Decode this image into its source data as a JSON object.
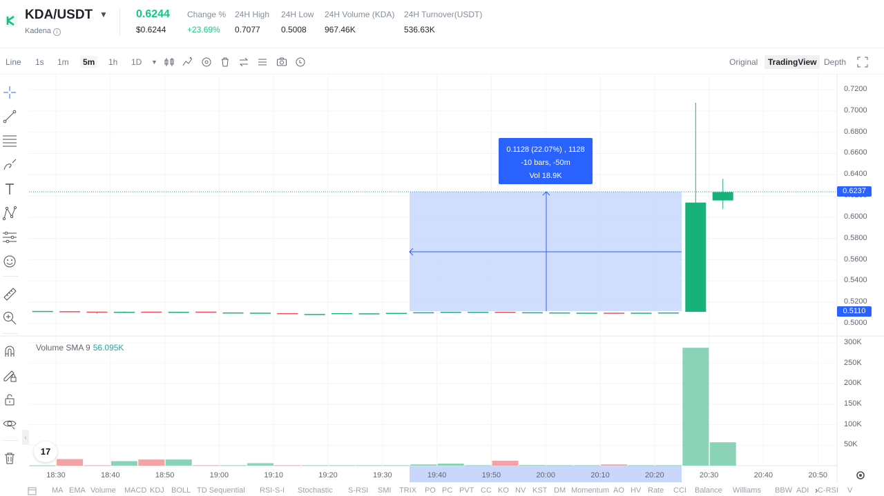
{
  "header": {
    "pair": "KDA/USDT",
    "name": "Kadena",
    "price": "0.6244",
    "price_usd": "$0.6244",
    "stats": [
      {
        "label": "Change %",
        "value": "+23.69%",
        "up": true
      },
      {
        "label": "24H High",
        "value": "0.7077"
      },
      {
        "label": "24H Low",
        "value": "0.5008"
      },
      {
        "label": "24H Volume (KDA)",
        "value": "967.46K"
      },
      {
        "label": "24H Turnover(USDT)",
        "value": "536.63K"
      }
    ]
  },
  "toolbar": {
    "intervals": [
      "Line",
      "1s",
      "1m",
      "5m",
      "1h",
      "1D"
    ],
    "active_interval": "5m",
    "views": [
      "Original",
      "TradingView",
      "Depth"
    ],
    "active_view": "TradingView"
  },
  "chart_data": {
    "type": "candlestick",
    "y_ticks": [
      "0.7200",
      "0.7000",
      "0.6800",
      "0.6600",
      "0.6400",
      "0.6200",
      "0.6000",
      "0.5800",
      "0.5600",
      "0.5400",
      "0.5200",
      "0.5000"
    ],
    "ylim": [
      0.4995,
      0.7215
    ],
    "current_price_tag": "0.6237",
    "measure_low_tag": "0.5110",
    "measure_tooltip": {
      "line1": "0.1128 (22.07%) , 1128",
      "line2": "-10 bars, -50m",
      "line3": "Vol 18.9K"
    },
    "candles": [
      {
        "o": 0.5118,
        "c": 0.5118,
        "h": 0.5118,
        "l": 0.5118,
        "up": true
      },
      {
        "o": 0.5116,
        "c": 0.5114,
        "h": 0.5116,
        "l": 0.5112,
        "up": false
      },
      {
        "o": 0.5112,
        "c": 0.5108,
        "h": 0.5112,
        "l": 0.5094,
        "up": false
      },
      {
        "o": 0.5104,
        "c": 0.511,
        "h": 0.5114,
        "l": 0.5104,
        "up": true
      },
      {
        "o": 0.5112,
        "c": 0.5108,
        "h": 0.5112,
        "l": 0.5108,
        "up": false
      },
      {
        "o": 0.5104,
        "c": 0.511,
        "h": 0.5112,
        "l": 0.5104,
        "up": true
      },
      {
        "o": 0.5112,
        "c": 0.5106,
        "h": 0.5112,
        "l": 0.5106,
        "up": false
      },
      {
        "o": 0.5104,
        "c": 0.5104,
        "h": 0.5104,
        "l": 0.5104,
        "up": true
      },
      {
        "o": 0.5102,
        "c": 0.5102,
        "h": 0.5102,
        "l": 0.5102,
        "up": true
      },
      {
        "o": 0.5098,
        "c": 0.5092,
        "h": 0.5098,
        "l": 0.509,
        "up": false
      },
      {
        "o": 0.509,
        "c": 0.509,
        "h": 0.509,
        "l": 0.509,
        "up": true
      },
      {
        "o": 0.5094,
        "c": 0.5098,
        "h": 0.5098,
        "l": 0.5094,
        "up": true
      },
      {
        "o": 0.5096,
        "c": 0.5096,
        "h": 0.5096,
        "l": 0.5096,
        "up": true
      },
      {
        "o": 0.51,
        "c": 0.51,
        "h": 0.51,
        "l": 0.51,
        "up": true
      },
      {
        "o": 0.5102,
        "c": 0.5106,
        "h": 0.5106,
        "l": 0.5102,
        "up": true
      },
      {
        "o": 0.5108,
        "c": 0.511,
        "h": 0.511,
        "l": 0.5108,
        "up": true
      },
      {
        "o": 0.511,
        "c": 0.511,
        "h": 0.511,
        "l": 0.511,
        "up": true
      },
      {
        "o": 0.511,
        "c": 0.5106,
        "h": 0.511,
        "l": 0.5106,
        "up": false
      },
      {
        "o": 0.5106,
        "c": 0.5104,
        "h": 0.5106,
        "l": 0.5104,
        "up": true
      },
      {
        "o": 0.5104,
        "c": 0.5104,
        "h": 0.5104,
        "l": 0.5104,
        "up": true
      },
      {
        "o": 0.5102,
        "c": 0.5102,
        "h": 0.5102,
        "l": 0.5102,
        "up": true
      },
      {
        "o": 0.5102,
        "c": 0.51,
        "h": 0.5102,
        "l": 0.51,
        "up": false
      },
      {
        "o": 0.5102,
        "c": 0.5102,
        "h": 0.5102,
        "l": 0.5102,
        "up": true
      },
      {
        "o": 0.5104,
        "c": 0.5104,
        "h": 0.5104,
        "l": 0.5104,
        "up": true
      },
      {
        "o": 0.511,
        "c": 0.6138,
        "h": 0.7077,
        "l": 0.511,
        "up": true
      },
      {
        "o": 0.6158,
        "c": 0.6237,
        "h": 0.6362,
        "l": 0.608,
        "up": true
      }
    ],
    "volume_legend": {
      "label": "Volume SMA 9",
      "value": "56.095K"
    },
    "volume_ticks": [
      "300K",
      "250K",
      "200K",
      "150K",
      "100K",
      "50K"
    ],
    "volume_ylim": [
      0,
      300000
    ],
    "volumes": [
      600,
      16000,
      900,
      11000,
      15000,
      15000,
      1000,
      1000,
      6000,
      1000,
      1000,
      1000,
      1000,
      1000,
      3000,
      5000,
      1000,
      12000,
      1500,
      1000,
      1000,
      3000,
      1000,
      1000,
      288000,
      57000
    ],
    "x_ticks": [
      "18:30",
      "18:40",
      "18:50",
      "19:00",
      "19:10",
      "19:20",
      "19:30",
      "19:40",
      "19:50",
      "20:00",
      "20:10",
      "20:20",
      "20:30",
      "20:40",
      "20:50"
    ]
  },
  "indicators": [
    "MA",
    "EMA",
    "Volume",
    "MACD",
    "KDJ",
    "BOLL",
    "TD Sequential",
    "RSI-S-I",
    "Stochastic",
    "S-RSI",
    "SMI",
    "TRIX",
    "PO",
    "PC",
    "PVT",
    "CC",
    "KO",
    "NV",
    "KST",
    "DM",
    "Momentum",
    "AO",
    "HV",
    "Rate",
    "CCI",
    "Balance",
    "Williams",
    "BBW",
    "ADI",
    "C-RSI",
    "V"
  ],
  "colors": {
    "up": "#16b27a",
    "down": "#e8505b",
    "vol_up": "#8ad3b6",
    "vol_down": "#f2a3a8",
    "accent": "#2962ff",
    "measure_fill": "#c8d7fb"
  },
  "icons": [
    "crosshair-icon",
    "trendline-icon",
    "fib-icon",
    "brush-icon",
    "text-icon",
    "pattern-icon",
    "prediction-icon",
    "emoji-icon",
    "ruler-icon",
    "zoom-icon",
    "magnet-icon",
    "lock-drawing-icon",
    "lock-icon",
    "eye-icon",
    "trash-icon"
  ]
}
